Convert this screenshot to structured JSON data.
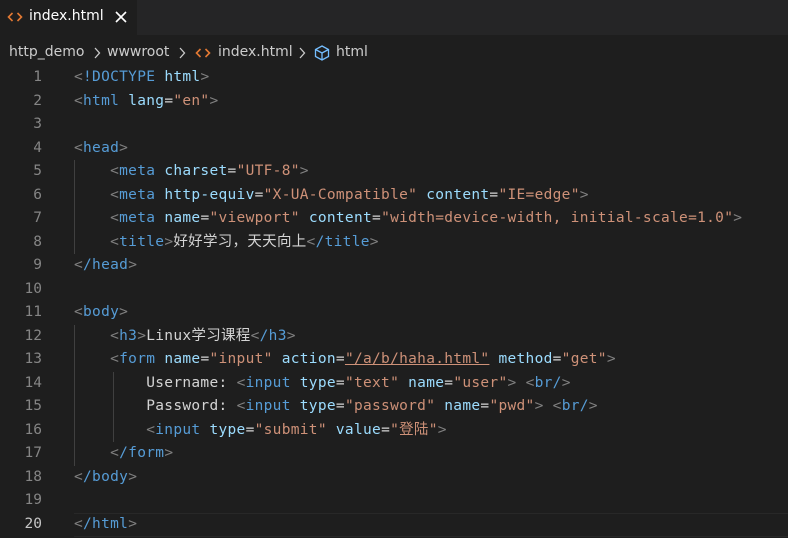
{
  "tab": {
    "label": "index.html",
    "icon": "html-file-icon",
    "close_icon": "close-icon"
  },
  "breadcrumb": {
    "items": [
      "http_demo",
      "wwwroot",
      "index.html",
      "html"
    ]
  },
  "colors": {
    "tag": "#569cd6",
    "attr": "#9cdcfe",
    "string": "#ce9178",
    "bracket": "#808080",
    "text": "#d4d4d4",
    "file_icon": "#e37933"
  },
  "editor": {
    "active_line": 20,
    "lines": [
      {
        "n": "1"
      },
      {
        "n": "2"
      },
      {
        "n": "3"
      },
      {
        "n": "4"
      },
      {
        "n": "5"
      },
      {
        "n": "6"
      },
      {
        "n": "7"
      },
      {
        "n": "8"
      },
      {
        "n": "9"
      },
      {
        "n": "10"
      },
      {
        "n": "11"
      },
      {
        "n": "12"
      },
      {
        "n": "13"
      },
      {
        "n": "14"
      },
      {
        "n": "15"
      },
      {
        "n": "16"
      },
      {
        "n": "17"
      },
      {
        "n": "18"
      },
      {
        "n": "19"
      },
      {
        "n": "20"
      }
    ],
    "code": {
      "l1": {
        "doctype": "!DOCTYPE",
        "html": "html"
      },
      "l2": {
        "tag": "html",
        "attr": "lang",
        "val": "\"en\""
      },
      "l4": {
        "tag": "head"
      },
      "l5": {
        "tag": "meta",
        "attr": "charset",
        "val": "\"UTF-8\""
      },
      "l6": {
        "tag": "meta",
        "attr1": "http-equiv",
        "val1": "\"X-UA-Compatible\"",
        "attr2": "content",
        "val2": "\"IE=edge\""
      },
      "l7": {
        "tag": "meta",
        "attr1": "name",
        "val1": "\"viewport\"",
        "attr2": "content",
        "val2": "\"width=device-width, initial-scale=1.0\""
      },
      "l8": {
        "tag": "title",
        "text": "好好学习，天天向上",
        "close": "/title"
      },
      "l9": {
        "tag": "/head"
      },
      "l11": {
        "tag": "body"
      },
      "l12": {
        "tag": "h3",
        "text": "Linux学习课程",
        "close": "/h3"
      },
      "l13": {
        "tag": "form",
        "attr1": "name",
        "val1": "\"input\"",
        "attr2": "action",
        "val2": "\"/a/b/haha.html\"",
        "attr3": "method",
        "val3": "\"get\""
      },
      "l14": {
        "text": "Username: ",
        "tag": "input",
        "attr1": "type",
        "val1": "\"text\"",
        "attr2": "name",
        "val2": "\"user\"",
        "br": "br/"
      },
      "l15": {
        "text": "Password: ",
        "tag": "input",
        "attr1": "type",
        "val1": "\"password\"",
        "attr2": "name",
        "val2": "\"pwd\"",
        "br": "br/"
      },
      "l16": {
        "tag": "input",
        "attr1": "type",
        "val1": "\"submit\"",
        "attr2": "value",
        "val2": "\"登陆\""
      },
      "l17": {
        "tag": "/form"
      },
      "l18": {
        "tag": "/body"
      },
      "l20": {
        "tag": "/html"
      }
    }
  }
}
